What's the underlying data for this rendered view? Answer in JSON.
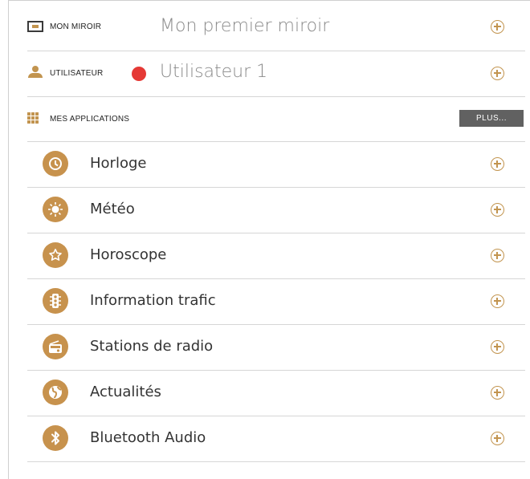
{
  "header": {
    "mirror_label": "MON MIROIR",
    "mirror_value": "Mon premier miroir",
    "user_label": "UTILISATEUR",
    "user_value": "Utilisateur 1",
    "user_dot_color": "#e53935",
    "apps_label": "MES APPLICATIONS",
    "more_button": "PLUS..."
  },
  "accent_color": "#c2944f",
  "apps": [
    {
      "label": "Horloge",
      "icon": "clock-icon"
    },
    {
      "label": "Météo",
      "icon": "sun-icon"
    },
    {
      "label": "Horoscope",
      "icon": "star-icon"
    },
    {
      "label": "Information trafic",
      "icon": "traffic-light-icon"
    },
    {
      "label": "Stations de radio",
      "icon": "radio-icon"
    },
    {
      "label": "Actualités",
      "icon": "globe-icon"
    },
    {
      "label": "Bluetooth Audio",
      "icon": "bluetooth-icon"
    }
  ]
}
